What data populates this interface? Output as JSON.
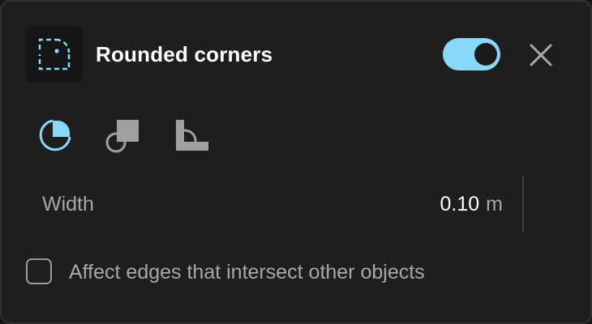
{
  "header": {
    "title": "Rounded corners",
    "icon": "rounded-corner-icon",
    "toggle_on": true,
    "close_icon": "close-icon"
  },
  "corner_styles": [
    {
      "icon": "round-corner-style-icon",
      "selected": true
    },
    {
      "icon": "chamfer-corner-style-icon",
      "selected": false
    },
    {
      "icon": "inner-round-corner-style-icon",
      "selected": false
    }
  ],
  "width": {
    "label": "Width",
    "value": "0.10",
    "unit": "m"
  },
  "affect_edges": {
    "label": "Affect edges that intersect other objects",
    "checked": false
  },
  "colors": {
    "accent": "#8ad8f8",
    "panel_bg": "#1e1e1e",
    "text": "#ffffff",
    "muted_text": "#a8a8a8",
    "icon_inactive": "#a0a0a0"
  }
}
